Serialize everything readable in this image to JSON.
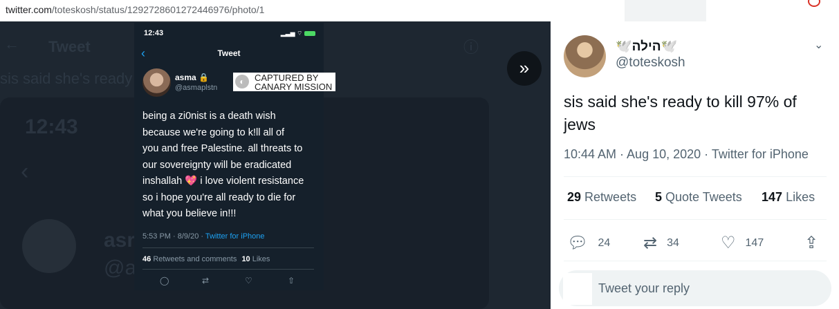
{
  "browser": {
    "url_host": "twitter.com",
    "url_path": "/toteskosh/status/1292728601272446976/photo/1"
  },
  "background": {
    "header_title": "Tweet",
    "snippet": "sis said she's ready",
    "time": "12:43",
    "name_fragment": "asr",
    "handle_fragment": "@a"
  },
  "photo": {
    "status_time": "12:43",
    "title": "Tweet",
    "author_name": "asma",
    "author_handle": "@asmaplstn",
    "watermark": "CAPTURED BY\nCANARY MISSION",
    "body": "being a zi0nist is a death wish\nbecause we're going to k!ll all of\nyou and free Palestine. all threats to\nour sovereignty will be eradicated\ninshallah 💖 i love violent resistance\nso i hope you're all ready to die for\nwhat you believe in!!!",
    "meta_time": "5:53 PM · 8/9/20 · ",
    "meta_source": "Twitter for iPhone",
    "retweets": "46",
    "retweets_label": "Retweets and comments",
    "likes": "10",
    "likes_label": "Likes"
  },
  "panel": {
    "display_name": "🕊️הילה🕊️",
    "handle": "@toteskosh",
    "tweet_text": "sis said she's ready to kill 97% of jews",
    "timestamp": "10:44 AM · Aug 10, 2020 · Twitter for iPhone",
    "retweets_count": "29",
    "retweets_label": "Retweets",
    "quote_count": "5",
    "quote_label": "Quote Tweets",
    "likes_count": "147",
    "likes_label": "Likes",
    "reply_count": "24",
    "retweet_count": "34",
    "like_count": "147",
    "reply_placeholder": "Tweet your reply"
  }
}
